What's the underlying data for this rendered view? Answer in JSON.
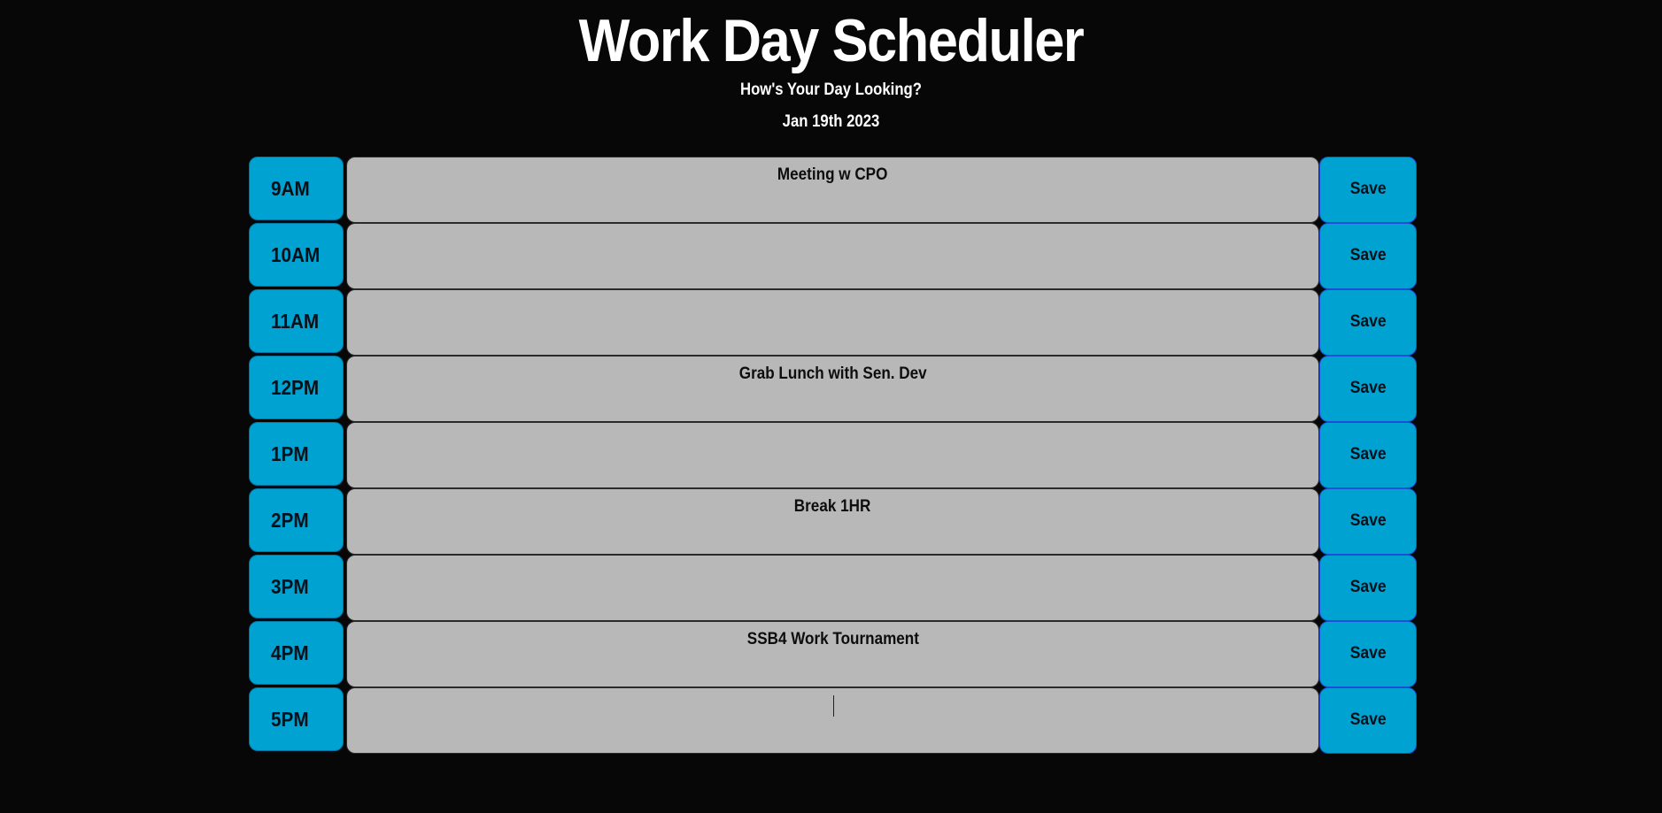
{
  "header": {
    "title": "Work Day Scheduler",
    "subtitle": "How's Your Day Looking?",
    "date": "Jan 19th 2023"
  },
  "schedule": [
    {
      "hour": "9AM",
      "task": "Meeting w CPO",
      "save_label": "Save"
    },
    {
      "hour": "10AM",
      "task": "",
      "save_label": "Save"
    },
    {
      "hour": "11AM",
      "task": "",
      "save_label": "Save"
    },
    {
      "hour": "12PM",
      "task": "Grab Lunch with Sen. Dev",
      "save_label": "Save"
    },
    {
      "hour": "1PM",
      "task": "",
      "save_label": "Save"
    },
    {
      "hour": "2PM",
      "task": "Break 1HR",
      "save_label": "Save"
    },
    {
      "hour": "3PM",
      "task": "",
      "save_label": "Save"
    },
    {
      "hour": "4PM",
      "task": "SSB4 Work Tournament",
      "save_label": "Save"
    },
    {
      "hour": "5PM",
      "task": "",
      "save_label": "Save"
    }
  ],
  "colors": {
    "background": "#070707",
    "hour_block": "#00a2d1",
    "task_field": "#b8b8b8",
    "save_button": "#00a2d1"
  }
}
